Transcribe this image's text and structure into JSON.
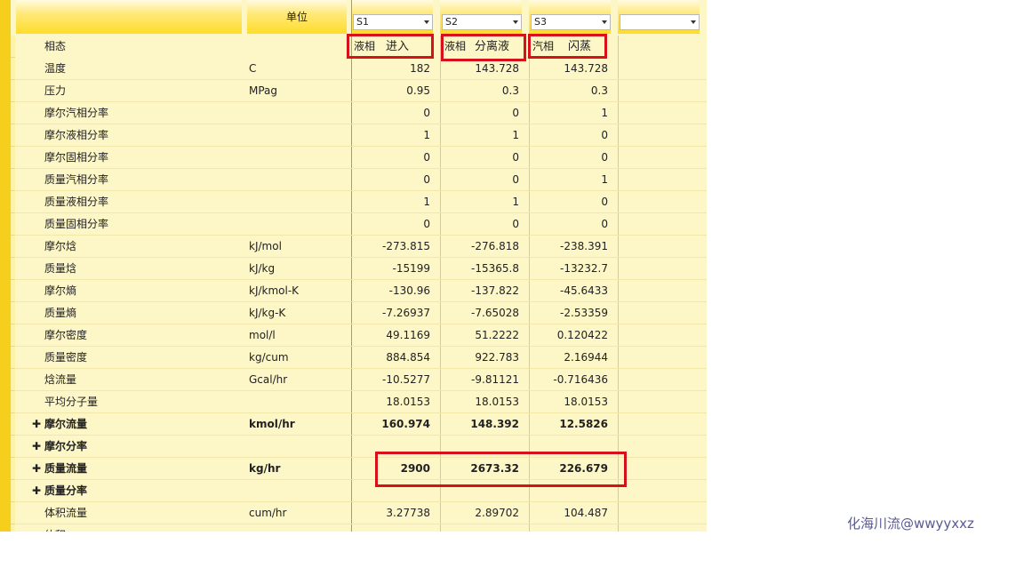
{
  "header": {
    "unit_label": "单位",
    "streams": [
      {
        "label": "S1"
      },
      {
        "label": "S2"
      },
      {
        "label": "S3"
      },
      {
        "label": ""
      }
    ]
  },
  "phase_row": {
    "label": "相态",
    "values": [
      {
        "phase": "液相",
        "note": "进入"
      },
      {
        "phase": "液相",
        "note": "分离液"
      },
      {
        "phase": "汽相",
        "note": "闪蒸"
      }
    ]
  },
  "rows": [
    {
      "label": "温度",
      "unit": "C",
      "v1": "182",
      "v2": "143.728",
      "v3": "143.728"
    },
    {
      "label": "压力",
      "unit": "MPag",
      "v1": "0.95",
      "v2": "0.3",
      "v3": "0.3"
    },
    {
      "label": "摩尔汽相分率",
      "unit": "",
      "v1": "0",
      "v2": "0",
      "v3": "1"
    },
    {
      "label": "摩尔液相分率",
      "unit": "",
      "v1": "1",
      "v2": "1",
      "v3": "0"
    },
    {
      "label": "摩尔固相分率",
      "unit": "",
      "v1": "0",
      "v2": "0",
      "v3": "0"
    },
    {
      "label": "质量汽相分率",
      "unit": "",
      "v1": "0",
      "v2": "0",
      "v3": "1"
    },
    {
      "label": "质量液相分率",
      "unit": "",
      "v1": "1",
      "v2": "1",
      "v3": "0"
    },
    {
      "label": "质量固相分率",
      "unit": "",
      "v1": "0",
      "v2": "0",
      "v3": "0"
    },
    {
      "label": "摩尔焓",
      "unit": "kJ/mol",
      "v1": "-273.815",
      "v2": "-276.818",
      "v3": "-238.391"
    },
    {
      "label": "质量焓",
      "unit": "kJ/kg",
      "v1": "-15199",
      "v2": "-15365.8",
      "v3": "-13232.7"
    },
    {
      "label": "摩尔熵",
      "unit": "kJ/kmol-K",
      "v1": "-130.96",
      "v2": "-137.822",
      "v3": "-45.6433"
    },
    {
      "label": "质量熵",
      "unit": "kJ/kg-K",
      "v1": "-7.26937",
      "v2": "-7.65028",
      "v3": "-2.53359"
    },
    {
      "label": "摩尔密度",
      "unit": "mol/l",
      "v1": "49.1169",
      "v2": "51.2222",
      "v3": "0.120422"
    },
    {
      "label": "质量密度",
      "unit": "kg/cum",
      "v1": "884.854",
      "v2": "922.783",
      "v3": "2.16944"
    },
    {
      "label": "焓流量",
      "unit": "Gcal/hr",
      "v1": "-10.5277",
      "v2": "-9.81121",
      "v3": "-0.716436"
    },
    {
      "label": "平均分子量",
      "unit": "",
      "v1": "18.0153",
      "v2": "18.0153",
      "v3": "18.0153"
    },
    {
      "label": "摩尔流量",
      "unit": "kmol/hr",
      "v1": "160.974",
      "v2": "148.392",
      "v3": "12.5826",
      "expand": "✚",
      "bold": true
    },
    {
      "label": "摩尔分率",
      "unit": "",
      "v1": "",
      "v2": "",
      "v3": "",
      "expand": "✚",
      "bold": true
    },
    {
      "label": "质量流量",
      "unit": "kg/hr",
      "v1": "2900",
      "v2": "2673.32",
      "v3": "226.679",
      "expand": "✚",
      "bold": true
    },
    {
      "label": "质量分率",
      "unit": "",
      "v1": "",
      "v2": "",
      "v3": "",
      "expand": "✚",
      "bold": true
    },
    {
      "label": "体积流量",
      "unit": "cum/hr",
      "v1": "3.27738",
      "v2": "2.89702",
      "v3": "104.487"
    },
    {
      "label": "体积",
      "unit": "",
      "v1": "",
      "v2": "",
      "v3": ""
    }
  ],
  "watermark": "化海川流@wwyyxxz",
  "colors": {
    "highlight_box": "#d8101a",
    "grid_bg": "#fdf6c6",
    "header_gold": "#ffdc2a"
  }
}
